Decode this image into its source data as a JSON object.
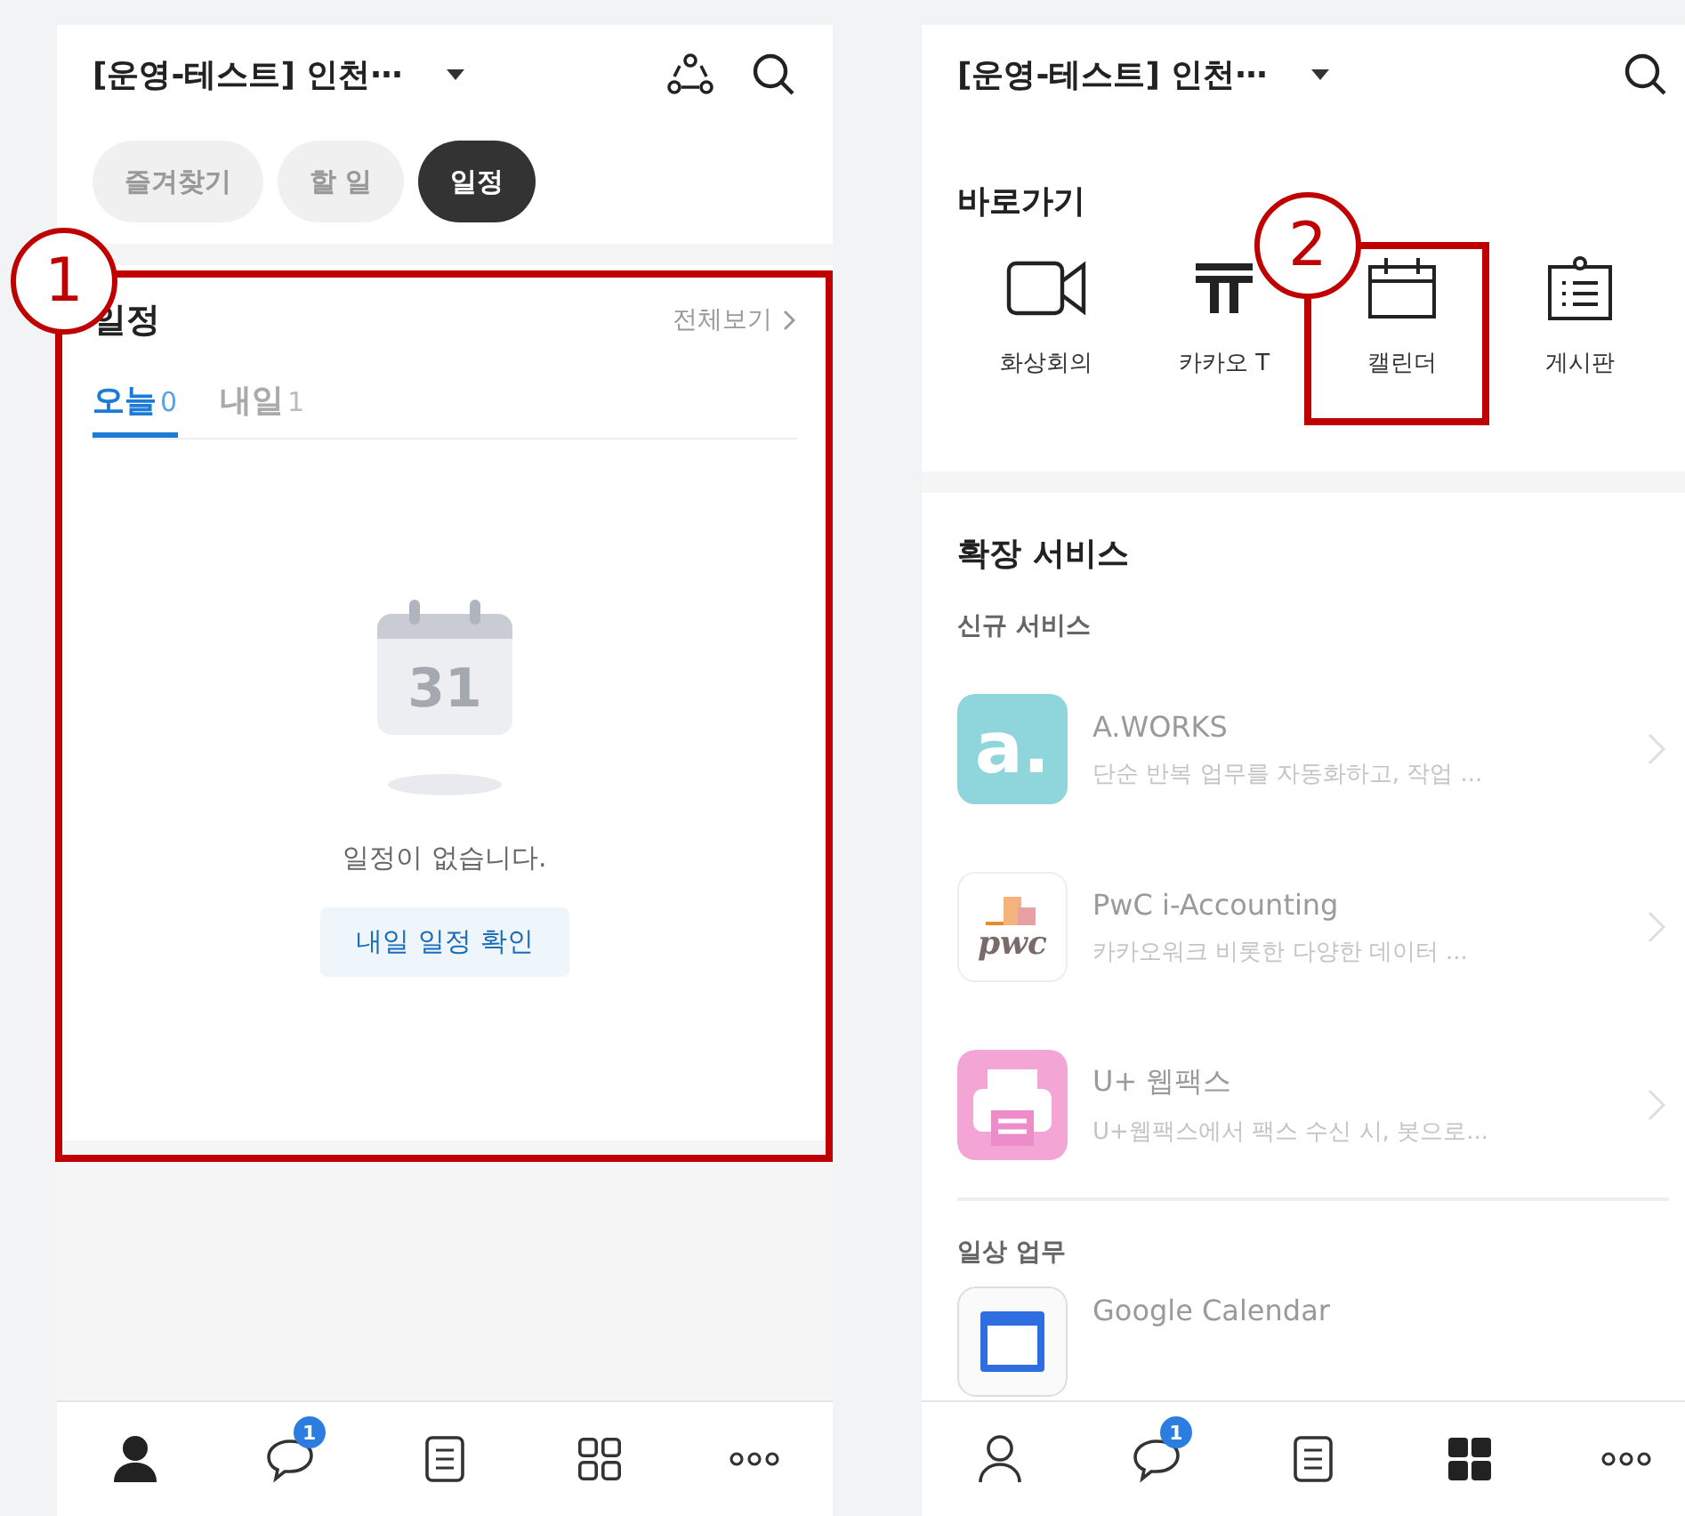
{
  "left": {
    "header": {
      "title": "[운영-테스트] 인천⋯"
    },
    "chips": [
      {
        "label": "즐겨찾기",
        "selected": false
      },
      {
        "label": "할 일",
        "selected": false
      },
      {
        "label": "일정",
        "selected": true
      }
    ],
    "schedule": {
      "title": "일정",
      "view_all": "전체보기",
      "tabs": [
        {
          "label": "오늘",
          "count": "0",
          "selected": true
        },
        {
          "label": "내일",
          "count": "1",
          "selected": false
        }
      ],
      "empty_day": "31",
      "empty_text": "일정이 없습니다.",
      "button": "내일 일정 확인"
    },
    "nav": [
      {
        "kind": "profile",
        "selected": true
      },
      {
        "kind": "chat",
        "badge": "1",
        "selected": false
      },
      {
        "kind": "note",
        "selected": false
      },
      {
        "kind": "apps",
        "selected": false
      },
      {
        "kind": "more",
        "selected": false
      }
    ]
  },
  "right": {
    "header": {
      "title": "[운영-테스트] 인천⋯"
    },
    "shortcuts": {
      "title": "바로가기",
      "items": [
        {
          "kind": "video",
          "label": "화상회의"
        },
        {
          "kind": "kakao-t",
          "label": "카카오 T"
        },
        {
          "kind": "calendar",
          "label": "캘린더"
        },
        {
          "kind": "board",
          "label": "게시판"
        }
      ]
    },
    "extensions": {
      "title": "확장 서비스",
      "groups": [
        {
          "title": "신규 서비스",
          "items": [
            {
              "kind": "aworks",
              "logo": "a.",
              "name": "A.WORKS",
              "description": "단순 반복 업무를 자동화하고, 작업 ..."
            },
            {
              "kind": "pwc",
              "logo": "pwc",
              "name": "PwC i-Accounting",
              "description": "카카오워크 비롯한 다양한 데이터 ..."
            },
            {
              "kind": "fax",
              "name": "U+ 웹팩스",
              "description": "U+웹팩스에서 팩스 수신 시, 봇으로..."
            }
          ]
        },
        {
          "title": "일상 업무",
          "items": [
            {
              "kind": "gcal",
              "name": "Google Calendar"
            }
          ]
        }
      ]
    },
    "nav": [
      {
        "kind": "profile",
        "selected": false
      },
      {
        "kind": "chat",
        "badge": "1",
        "selected": false
      },
      {
        "kind": "note",
        "selected": false
      },
      {
        "kind": "apps",
        "selected": true
      },
      {
        "kind": "more",
        "selected": false
      }
    ]
  },
  "annotations": [
    {
      "number": "1"
    },
    {
      "number": "2"
    }
  ]
}
